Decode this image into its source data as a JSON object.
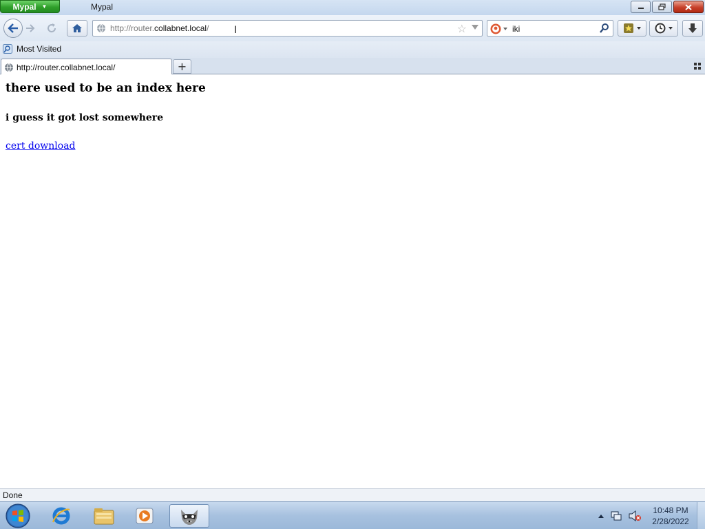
{
  "window": {
    "app_menu_label": "Mypal",
    "title": "Mypal"
  },
  "navbar": {
    "url_prefix": "http://router.",
    "url_host": "collabnet.local",
    "url_suffix": "/",
    "search_value": "iki",
    "search_engine_icon": "duckduckgo-icon"
  },
  "bookmarks": {
    "items": [
      {
        "label": "Most Visited",
        "icon": "most-visited-icon"
      }
    ]
  },
  "tabs": [
    {
      "label": "http://router.collabnet.local/",
      "icon": "globe-icon"
    }
  ],
  "page": {
    "heading": "there used to be an index here",
    "subheading": "i guess it got lost somewhere",
    "link_label": "cert download"
  },
  "status": {
    "text": "Done"
  },
  "taskbar": {
    "time": "10:48 PM",
    "date": "2/28/2022",
    "pinned": [
      "internet-explorer-icon",
      "file-explorer-icon",
      "media-player-icon",
      "mypal-raccoon-icon"
    ]
  },
  "colors": {
    "link": "#0000ee",
    "app_button": "#2f9f2b",
    "close_button": "#c7402a"
  }
}
